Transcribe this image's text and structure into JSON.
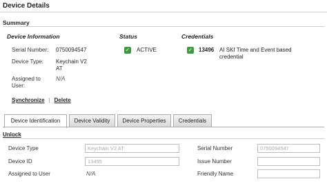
{
  "page_title": "Device Details",
  "summary_heading": "Summary",
  "device_info": {
    "heading": "Device Information",
    "serial_label": "Serial Number:",
    "serial_value": "0750094547",
    "type_label": "Device Type:",
    "type_value_line1": "Keychain V2",
    "type_value_line2": "AT",
    "assigned_label_line1": "Assigned to",
    "assigned_label_line2": "User:",
    "assigned_value": "N/A"
  },
  "status": {
    "heading": "Status",
    "value": "ACTIVE"
  },
  "credentials": {
    "heading": "Credentials",
    "id": "13496",
    "desc_line1": "AI SKI Time and Event based",
    "desc_line2": "credential"
  },
  "actions": {
    "synchronize": "Synchronize",
    "separator": "|",
    "delete": "Delete"
  },
  "tabs": [
    {
      "label": "Device Identification",
      "active": true
    },
    {
      "label": "Device Validity",
      "active": false
    },
    {
      "label": "Device Properties",
      "active": false
    },
    {
      "label": "Credentials",
      "active": false
    }
  ],
  "unlock_label": "Unlock",
  "form": {
    "device_type_label": "Device Type",
    "device_type_value": "Keychain V2 AT",
    "device_id_label": "Device ID",
    "device_id_value": "13495",
    "assigned_label": "Assigned to User",
    "assigned_value": "N/A",
    "serial_label": "Serial Number",
    "serial_value": "0750094547",
    "issue_label": "Issue Number",
    "issue_value": "",
    "friendly_label": "Friendly Name",
    "friendly_value": ""
  },
  "colors": {
    "check_green": "#3a9c3a",
    "tab_border": "#a9a9a9"
  }
}
